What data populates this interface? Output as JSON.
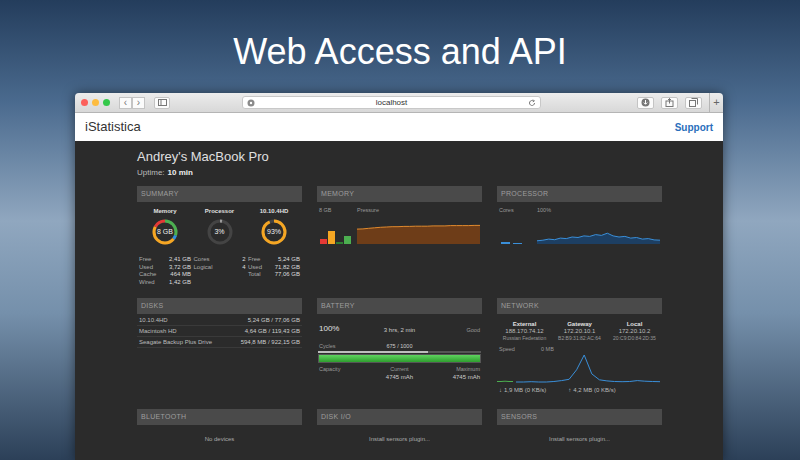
{
  "hero": {
    "title": "Web Access and API"
  },
  "browser": {
    "traffic_lights": [
      {
        "color": "#fc605c"
      },
      {
        "color": "#fdbc40"
      },
      {
        "color": "#34c84a"
      }
    ],
    "nav_buttons": [
      "‹",
      "›"
    ],
    "address": "localhost",
    "new_tab": "+"
  },
  "header": {
    "logo": "iStatistica",
    "support": "Support"
  },
  "device": {
    "name": "Andrey's MacBook Pro",
    "uptime_label": "Uptime:",
    "uptime": "10 min"
  },
  "summary": {
    "title": "SUMMARY",
    "gauges": [
      {
        "kind": "segmented",
        "label": "Memory",
        "value": "8 GB",
        "segments": [
          {
            "level": 0.3,
            "color": "#4caf50"
          },
          {
            "level": 0.058,
            "color": "#2f8fe0"
          },
          {
            "level": 0.465,
            "color": "#f5a623"
          },
          {
            "level": 0.177,
            "color": "#e53935"
          }
        ],
        "stats": [
          {
            "label": "Free",
            "value": "2,41 GB"
          },
          {
            "label": "Used",
            "value": "3,72 GB"
          },
          {
            "label": "Cache",
            "value": "464 MB"
          },
          {
            "label": "Wired",
            "value": "1,42 GB"
          }
        ]
      },
      {
        "kind": "single",
        "label": "Processor",
        "value": "3%",
        "level": 0.03,
        "color": "#9e9e9e",
        "stats": [
          {
            "label": "Cores",
            "value": "2"
          },
          {
            "label": "Logical",
            "value": "4"
          }
        ]
      },
      {
        "kind": "single",
        "label": "10.10.4HD",
        "value": "93%",
        "level": 0.93,
        "color": "#f5a623",
        "stats": [
          {
            "label": "Free",
            "value": "5,24 GB"
          },
          {
            "label": "Used",
            "value": "71,82 GB"
          },
          {
            "label": "Total",
            "value": "77,06 GB"
          }
        ]
      }
    ]
  },
  "memory": {
    "title": "MEMORY",
    "scale_label": "8 GB",
    "pressure_label": "Pressure",
    "bars_max": 8,
    "bars": [
      {
        "value": 1.42,
        "color": "#e53935"
      },
      {
        "value": 3.72,
        "color": "#f5a623"
      },
      {
        "value": 0.46,
        "color": "#2e7d32"
      },
      {
        "value": 2.41,
        "color": "#4caf50"
      }
    ],
    "pressure": [
      55,
      56,
      58,
      60,
      62,
      63,
      64,
      64,
      65,
      65,
      66,
      66,
      66,
      67,
      67,
      67,
      68,
      68,
      68,
      68,
      69,
      69
    ]
  },
  "processor": {
    "title": "PROCESSOR",
    "cores_label": "Cores",
    "scale_label": "100%",
    "cores": [
      7,
      4
    ],
    "load": [
      12,
      14,
      18,
      16,
      22,
      20,
      26,
      24,
      30,
      28,
      35,
      32,
      40,
      30,
      26,
      28,
      22,
      24,
      18,
      20,
      15,
      14
    ]
  },
  "disks": {
    "title": "DISKS",
    "rows": [
      {
        "name": "10.10.4HD",
        "usage": "5,24 GB / 77,06 GB"
      },
      {
        "name": "Macintosh HD",
        "usage": "4,64 GB / 119,43 GB"
      },
      {
        "name": "Seagate Backup Plus Drive",
        "usage": "594,8 MB / 922,15 GB"
      }
    ]
  },
  "battery": {
    "title": "BATTERY",
    "charge": "100%",
    "time": "3 hrs, 2 min",
    "health": "Good",
    "cycles_label": "Cycles",
    "cycles": "675 / 1000",
    "cycles_level": 0.675,
    "charge_level": 1.0,
    "labels": [
      "Capacity",
      "Current",
      "Maximum"
    ],
    "current": "4745 mAh",
    "maximum": "4745 mAh"
  },
  "network": {
    "title": "NETWORK",
    "addresses": [
      {
        "label": "External",
        "ip": "188.170.74.12",
        "detail": "Russian Federation"
      },
      {
        "label": "Gateway",
        "ip": "172.20.10.1",
        "detail": "B2:B9:31:82:AC:64"
      },
      {
        "label": "Local",
        "ip": "172.20.10.2",
        "detail": "20:C9:D0:84:2D:35"
      }
    ],
    "speed_label": "Speed",
    "scale_label": "0 MB",
    "download": [
      0.02,
      0.02,
      0.03,
      0.02,
      0.02
    ],
    "upload": [
      0,
      0,
      0.01,
      0,
      0,
      0.02,
      0.05,
      0.1,
      0.45,
      1.0,
      0.3,
      0.08,
      0.04,
      0.02,
      0.01,
      0.02,
      0.05,
      0.03,
      0.02,
      0.01
    ],
    "download_total": {
      "arrow": "↓",
      "text": "1,9 MB (0 KB/s)"
    },
    "upload_total": {
      "arrow": "↑",
      "text": "4,2 MB (0 KB/s)"
    }
  },
  "bluetooth": {
    "title": "BLUETOOTH",
    "message": "No devices"
  },
  "disk_io": {
    "title": "DISK I/O",
    "message": "Install sensors plugin..."
  },
  "sensors": {
    "title": "SENSORS",
    "message": "Install sensors plugin..."
  }
}
